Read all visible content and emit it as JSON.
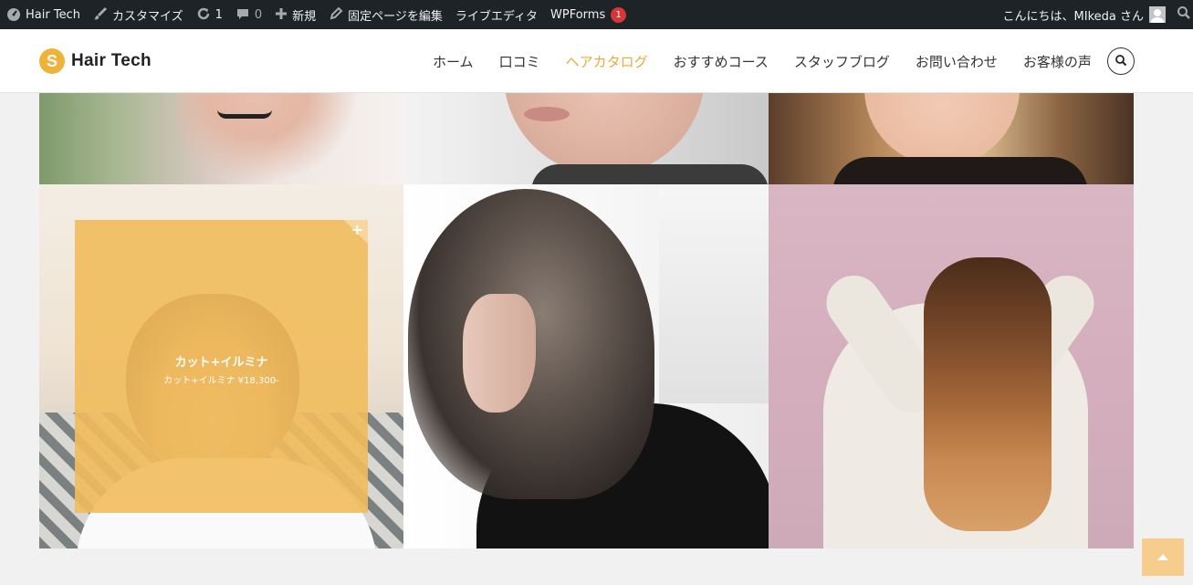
{
  "admin_bar": {
    "site_name": "Hair Tech",
    "customize": "カスタマイズ",
    "updates_count": "1",
    "comments_count": "0",
    "new": "新規",
    "edit_page": "固定ページを編集",
    "live_editor": "ライブエディタ",
    "wpforms": "WPForms",
    "wpforms_badge": "1",
    "greeting": "こんにちは、MIkeda さん"
  },
  "header": {
    "logo_text": "Hair Tech",
    "logo_mark": "S",
    "nav": [
      {
        "label": "ホーム"
      },
      {
        "label": "口コミ"
      },
      {
        "label": "ヘアカタログ",
        "active": true
      },
      {
        "label": "おすすめコース"
      },
      {
        "label": "スタッフブログ"
      },
      {
        "label": "お問い合わせ"
      },
      {
        "label": "お客様の声"
      }
    ],
    "accent_color": "#eaa93a"
  },
  "gallery": {
    "hover_item": {
      "title": "カット+イルミナ",
      "subtitle": "カット+イルミナ ¥18,300-",
      "overlay_color": "#f1bc5c"
    }
  },
  "back_to_top_icon": "chevron-up-icon"
}
